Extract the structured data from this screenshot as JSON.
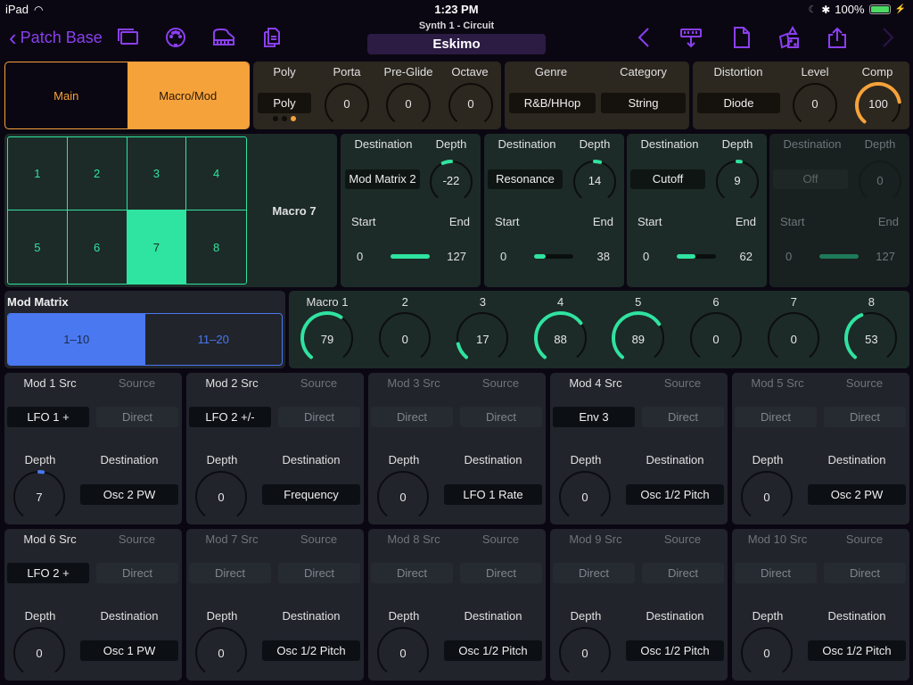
{
  "status": {
    "device": "iPad",
    "time": "1:23 PM",
    "battery": "100%"
  },
  "nav": {
    "back_label": "Patch Base",
    "synth_name": "Synth 1 - Circuit",
    "patch_name": "Eskimo",
    "left_icons": [
      "windows-icon",
      "midi-port-icon",
      "piano-icon",
      "copy-documents-icon"
    ],
    "right_icons": [
      "previous-icon",
      "send-to-synth-icon",
      "new-document-icon",
      "randomize-dice-icon",
      "share-icon",
      "next-icon"
    ]
  },
  "page_tabs": {
    "items": [
      "Main",
      "Macro/Mod"
    ],
    "selected": 1
  },
  "voice": {
    "poly_label": "Poly",
    "poly_value": "Poly",
    "page_dots": 3,
    "page_dot_active": 2,
    "knobs": [
      {
        "label": "Porta",
        "value": "0",
        "fraction": 0
      },
      {
        "label": "Pre-Glide",
        "value": "0",
        "fraction": 0
      },
      {
        "label": "Octave",
        "value": "0",
        "fraction": 0
      }
    ]
  },
  "genre": {
    "genre_label": "Genre",
    "genre_value": "R&B/HHop",
    "category_label": "Category",
    "category_value": "String"
  },
  "distortion": {
    "distortion_label": "Distortion",
    "distortion_value": "Diode",
    "level": {
      "label": "Level",
      "value": "0",
      "fraction": 0
    },
    "comp": {
      "label": "Comp",
      "value": "100",
      "fraction": 0.79
    }
  },
  "macro_select": {
    "cells": [
      "1",
      "2",
      "3",
      "4",
      "5",
      "6",
      "7",
      "8"
    ],
    "selected": 6,
    "title": "Macro 7"
  },
  "macro_destinations": [
    {
      "dest_label": "Destination",
      "depth_label": "Depth",
      "destination": "Mod Matrix 2",
      "depth": "-22",
      "depth_fraction": -0.17,
      "start_label": "Start",
      "end_label": "End",
      "start": "0",
      "end": "127",
      "range": [
        0,
        127
      ],
      "enabled": true
    },
    {
      "dest_label": "Destination",
      "depth_label": "Depth",
      "destination": "Resonance",
      "depth": "14",
      "depth_fraction": 0.11,
      "start_label": "Start",
      "end_label": "End",
      "start": "0",
      "end": "38",
      "range": [
        0,
        38
      ],
      "enabled": true
    },
    {
      "dest_label": "Destination",
      "depth_label": "Depth",
      "destination": "Cutoff",
      "depth": "9",
      "depth_fraction": 0.07,
      "start_label": "Start",
      "end_label": "End",
      "start": "0",
      "end": "62",
      "range": [
        0,
        62
      ],
      "enabled": true
    },
    {
      "dest_label": "Destination",
      "depth_label": "Depth",
      "destination": "Off",
      "depth": "0",
      "depth_fraction": 0,
      "start_label": "Start",
      "end_label": "End",
      "start": "0",
      "end": "127",
      "range": [
        0,
        127
      ],
      "enabled": false
    }
  ],
  "mod_matrix": {
    "title": "Mod Matrix",
    "tabs": [
      "1–10",
      "11–20"
    ],
    "selected": 0
  },
  "macro_knobs": [
    {
      "label": "Macro 1",
      "value": "79",
      "fraction": 0.62
    },
    {
      "label": "2",
      "value": "0",
      "fraction": 0
    },
    {
      "label": "3",
      "value": "17",
      "fraction": 0.13
    },
    {
      "label": "4",
      "value": "88",
      "fraction": 0.69
    },
    {
      "label": "5",
      "value": "89",
      "fraction": 0.7
    },
    {
      "label": "6",
      "value": "0",
      "fraction": 0
    },
    {
      "label": "7",
      "value": "0",
      "fraction": 0
    },
    {
      "label": "8",
      "value": "53",
      "fraction": 0.42
    }
  ],
  "mod_slots": [
    {
      "title": "Mod 1 Src",
      "source_label": "Source",
      "src1": "LFO 1 +",
      "src2": "Direct",
      "depth_label": "Depth",
      "depth": "7",
      "depth_fraction": 0.06,
      "dest_label": "Destination",
      "destination": "Osc 2 PW",
      "active": true
    },
    {
      "title": "Mod 2 Src",
      "source_label": "Source",
      "src1": "LFO 2 +/-",
      "src2": "Direct",
      "depth_label": "Depth",
      "depth": "0",
      "depth_fraction": 0,
      "dest_label": "Destination",
      "destination": "Frequency",
      "active": true
    },
    {
      "title": "Mod 3 Src",
      "source_label": "Source",
      "src1": "Direct",
      "src2": "Direct",
      "depth_label": "Depth",
      "depth": "0",
      "depth_fraction": 0,
      "dest_label": "Destination",
      "destination": "LFO 1 Rate",
      "active": false
    },
    {
      "title": "Mod 4 Src",
      "source_label": "Source",
      "src1": "Env 3",
      "src2": "Direct",
      "depth_label": "Depth",
      "depth": "0",
      "depth_fraction": 0,
      "dest_label": "Destination",
      "destination": "Osc 1/2 Pitch",
      "active": true
    },
    {
      "title": "Mod 5 Src",
      "source_label": "Source",
      "src1": "Direct",
      "src2": "Direct",
      "depth_label": "Depth",
      "depth": "0",
      "depth_fraction": 0,
      "dest_label": "Destination",
      "destination": "Osc 2 PW",
      "active": false
    },
    {
      "title": "Mod 6 Src",
      "source_label": "Source",
      "src1": "LFO 2 +",
      "src2": "Direct",
      "depth_label": "Depth",
      "depth": "0",
      "depth_fraction": 0,
      "dest_label": "Destination",
      "destination": "Osc 1 PW",
      "active": true
    },
    {
      "title": "Mod 7 Src",
      "source_label": "Source",
      "src1": "Direct",
      "src2": "Direct",
      "depth_label": "Depth",
      "depth": "0",
      "depth_fraction": 0,
      "dest_label": "Destination",
      "destination": "Osc 1/2 Pitch",
      "active": false
    },
    {
      "title": "Mod 8 Src",
      "source_label": "Source",
      "src1": "Direct",
      "src2": "Direct",
      "depth_label": "Depth",
      "depth": "0",
      "depth_fraction": 0,
      "dest_label": "Destination",
      "destination": "Osc 1/2 Pitch",
      "active": false
    },
    {
      "title": "Mod 9 Src",
      "source_label": "Source",
      "src1": "Direct",
      "src2": "Direct",
      "depth_label": "Depth",
      "depth": "0",
      "depth_fraction": 0,
      "dest_label": "Destination",
      "destination": "Osc 1/2 Pitch",
      "active": false
    },
    {
      "title": "Mod 10 Src",
      "source_label": "Source",
      "src1": "Direct",
      "src2": "Direct",
      "depth_label": "Depth",
      "depth": "0",
      "depth_fraction": 0,
      "dest_label": "Destination",
      "destination": "Osc 1/2 Pitch",
      "active": false
    }
  ],
  "colors": {
    "accent_purple": "#8a3ff0",
    "orange": "#f6a23b",
    "mint": "#2fe3a0",
    "blue": "#4a78f0"
  }
}
